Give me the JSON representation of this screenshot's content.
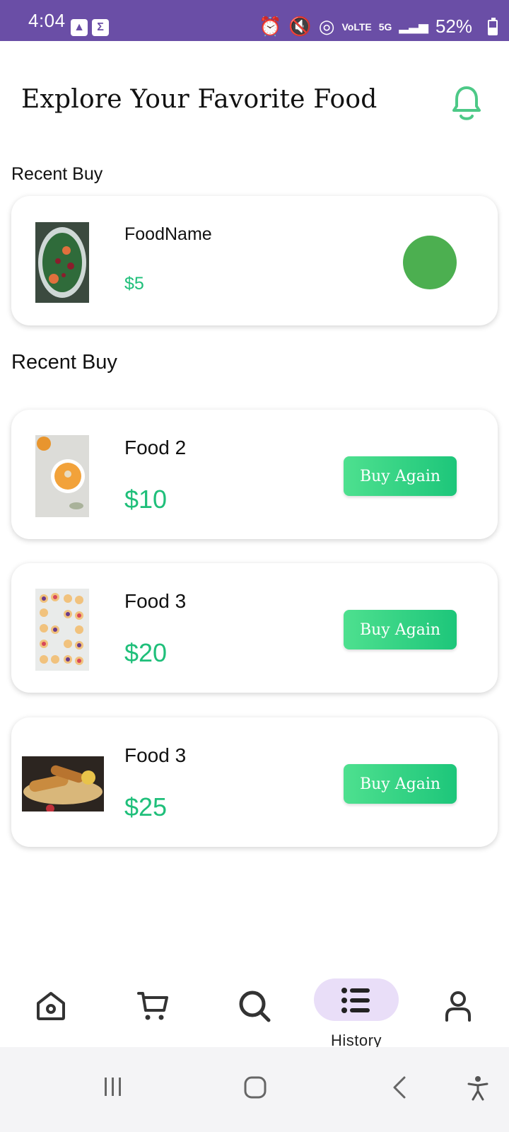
{
  "status_bar": {
    "time": "4:04",
    "network": "5G",
    "volte": "VoLTE",
    "battery_text": "52%",
    "battery_level": 0.52
  },
  "header": {
    "title": "Explore Your Favorite Food",
    "bell_icon": "bell-icon"
  },
  "recent_buy": {
    "label": "Recent Buy",
    "item": {
      "name": "FoodName",
      "price": "$5"
    }
  },
  "history": {
    "label": "Recent Buy",
    "items": [
      {
        "name": "Food 2",
        "price": "$10",
        "button": "Buy Again"
      },
      {
        "name": "Food 3",
        "price": "$20",
        "button": "Buy Again"
      },
      {
        "name": "Food 3",
        "price": "$25",
        "button": "Buy Again"
      }
    ]
  },
  "bottom_nav": {
    "items": [
      {
        "icon": "home-icon",
        "label": ""
      },
      {
        "icon": "cart-icon",
        "label": ""
      },
      {
        "icon": "search-icon",
        "label": ""
      },
      {
        "icon": "list-icon",
        "label": "History",
        "active": true
      },
      {
        "icon": "profile-icon",
        "label": ""
      }
    ]
  },
  "colors": {
    "status_bar": "#6a4ea6",
    "accent_green": "#1fbf7a",
    "dot_green": "#4caf50",
    "nav_active_pill": "#e9def8"
  }
}
